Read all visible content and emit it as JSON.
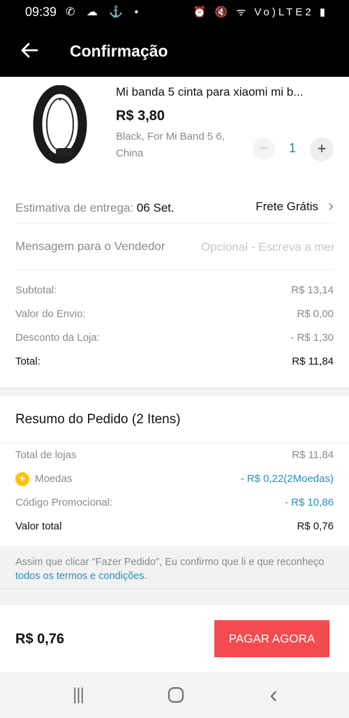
{
  "status_bar": {
    "time": "09:39",
    "left_icons": "✆ ☁ ⚓ •",
    "right_icons": "⏰ 🔇 ᯤ Vo)LTE2 ▮"
  },
  "app_bar": {
    "title": "Confirmação"
  },
  "product": {
    "title": "Mi banda 5 cinta para xiaomi mi b...",
    "price": "R$ 3,80",
    "variant": "Black, For Mi Band 5 6, China",
    "quantity": "1",
    "minus_symbol": "−",
    "plus_symbol": "+"
  },
  "delivery": {
    "label": "Estimativa de entrega: ",
    "date": "06 Set.",
    "shipping": "Frete Grátis",
    "chevron": "›"
  },
  "message": {
    "label": "Mensagem para o Vendedor",
    "placeholder": "Opcional - Escreva a mensagem"
  },
  "store_summary": [
    {
      "label": "Subtotal:",
      "value": "R$ 13,14"
    },
    {
      "label": "Valor do Envio:",
      "value": "R$ 0,00"
    },
    {
      "label": "Desconto da Loja:",
      "value": "- R$ 1,30"
    },
    {
      "label": "Total:",
      "value": "R$ 11,84"
    }
  ],
  "order_summary": {
    "title": "Resumo do Pedido (2 Itens)",
    "rows": [
      {
        "label": "Total de lojas",
        "value": "R$ 11,84"
      },
      {
        "label": "Moedas",
        "value": "- R$ 0,22(2Moedas)"
      },
      {
        "label": "Código Promocional:",
        "value": "- R$ 10,86"
      },
      {
        "label": "Valor total",
        "value": "R$ 0,76"
      }
    ]
  },
  "terms": {
    "text": "Assim que clicar \"Fazer Pedido\", Eu confirmo que li e que reconheço ",
    "link": "todos os termos e condições",
    "end": "."
  },
  "bottom": {
    "total": "R$ 0,76",
    "pay_label": "PAGAR AGORA"
  },
  "nav": {
    "recents": "|||",
    "home": "○",
    "back": "‹"
  },
  "colors": {
    "accent_red": "#f34b4f",
    "link_blue": "#2b8fb8",
    "coin_yellow": "#ffc20e"
  }
}
